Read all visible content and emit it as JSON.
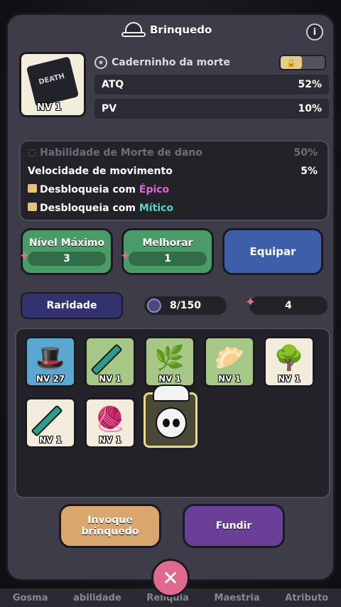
{
  "header": {
    "title": "Brinquedo",
    "hat_icon": "helmet-icon",
    "info_icon": "info-icon"
  },
  "item": {
    "card_label": "DEATH",
    "level": "NV 1",
    "name": "Caderninho da morte",
    "locked": true,
    "stats": [
      {
        "label": "ATQ",
        "value": "52%"
      },
      {
        "label": "PV",
        "value": "10%"
      }
    ]
  },
  "abilities": {
    "locked_hidden": {
      "label": "Habilidade de Morte de dano",
      "value": "50%"
    },
    "active": {
      "label": "Velocidade de movimento",
      "value": "5%"
    },
    "unlock_epic": {
      "prefix": "Desbloqueia com",
      "rarity": "Épico",
      "color": "#e066d8"
    },
    "unlock_mythic": {
      "prefix": "Desbloqueia com",
      "rarity": "Mítico",
      "color": "#58d6c7"
    }
  },
  "actions": {
    "max_level": {
      "label": "Nível Máximo",
      "value": "3"
    },
    "upgrade": {
      "label": "Melhorar",
      "value": "1"
    },
    "equip": {
      "label": "Equipar"
    }
  },
  "inventory_bar": {
    "rarity_label": "Raridade",
    "capacity": "8/150",
    "bones": "4"
  },
  "inventory": {
    "items": [
      {
        "name": "hat-item",
        "level": "NV 27",
        "rarity": "blue"
      },
      {
        "name": "sword-item",
        "level": "NV 1",
        "rarity": "green"
      },
      {
        "name": "leaf-item",
        "level": "NV 1",
        "rarity": "green"
      },
      {
        "name": "bun-item",
        "level": "NV 1",
        "rarity": "green"
      },
      {
        "name": "branch-item",
        "level": "NV 1",
        "rarity": "white"
      },
      {
        "name": "sword-item",
        "level": "NV 1",
        "rarity": "white"
      },
      {
        "name": "rope-item",
        "level": "NV 1",
        "rarity": "white"
      },
      {
        "name": "chef-skull-item",
        "level": "",
        "rarity": "selected"
      }
    ]
  },
  "bottom_buttons": {
    "summon": "Invoque brinquedo",
    "merge": "Fundir"
  },
  "close": "✕",
  "nav": [
    "Gosma",
    "abilidade",
    "Relíquia",
    "Maestria",
    "Atributo"
  ],
  "colors": {
    "panel": "#3d3c48",
    "green_btn": "#4a9b68",
    "blue_btn": "#3d5ea8",
    "summon_btn": "#d9a66d",
    "merge_btn": "#6b3e98"
  }
}
